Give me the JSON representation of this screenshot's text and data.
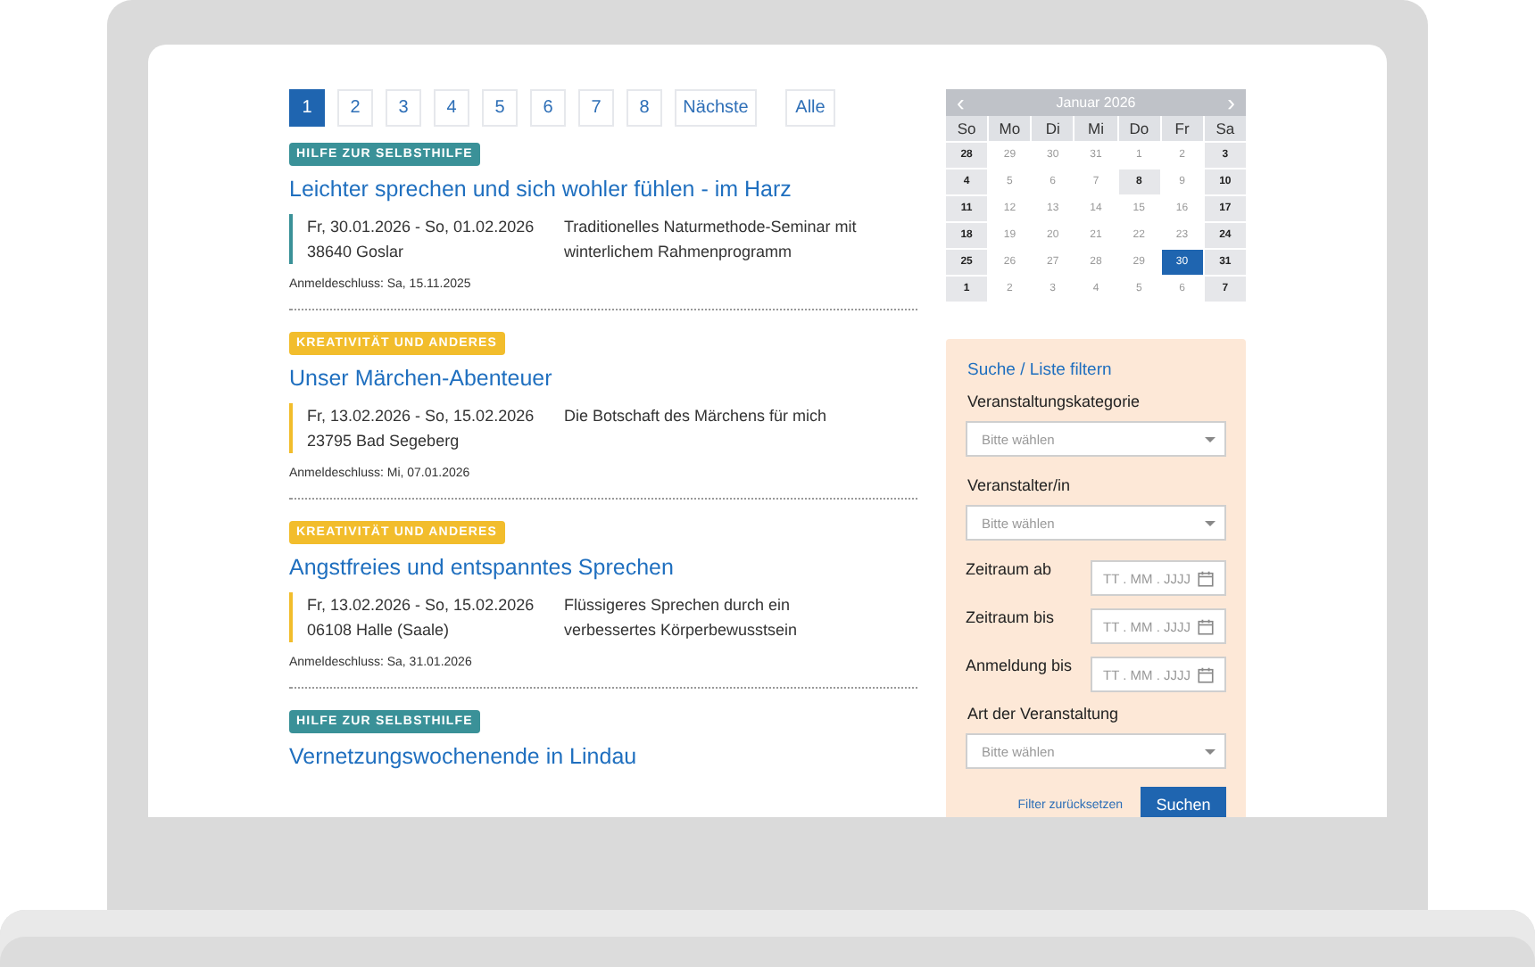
{
  "pagination": {
    "pages": [
      {
        "label": "1",
        "selected": true
      },
      {
        "label": "2",
        "selected": false
      },
      {
        "label": "3",
        "selected": false
      },
      {
        "label": "4",
        "selected": false
      },
      {
        "label": "5",
        "selected": false
      },
      {
        "label": "6",
        "selected": false
      },
      {
        "label": "7",
        "selected": false
      },
      {
        "label": "8",
        "selected": false
      }
    ],
    "next": "Nächste",
    "all": "Alle"
  },
  "events": [
    {
      "category": "HILFE ZUR SELBSTHILFE",
      "color": "#3a9198",
      "title": "Leichter sprechen und sich wohler fühlen - im Harz",
      "dates": "Fr, 30.01.2026 - So, 01.02.2026",
      "location": "38640 Goslar",
      "description": "Traditionelles Naturmethode-Seminar mit winterlichem Rahmenprogramm",
      "deadline": "Anmeldeschluss: Sa, 15.11.2025"
    },
    {
      "category": "KREATIVITÄT UND ANDERES",
      "color": "#f2bd2c",
      "title": "Unser Märchen-Abenteuer",
      "dates": "Fr, 13.02.2026 - So, 15.02.2026",
      "location": "23795 Bad Segeberg",
      "description": "Die Botschaft des Märchens für mich",
      "deadline": "Anmeldeschluss: Mi, 07.01.2026"
    },
    {
      "category": "KREATIVITÄT UND ANDERES",
      "color": "#f2bd2c",
      "title": "Angstfreies und entspanntes Sprechen",
      "dates": "Fr, 13.02.2026 - So, 15.02.2026",
      "location": "06108 Halle (Saale)",
      "description": "Flüssigeres Sprechen durch ein verbessertes Körperbewusstsein",
      "deadline": "Anmeldeschluss: Sa, 31.01.2026"
    },
    {
      "category": "HILFE ZUR SELBSTHILFE",
      "color": "#3a9198",
      "title": "Vernetzungswochenende in Lindau"
    }
  ],
  "calendar": {
    "title": "Januar 2026",
    "prev": "‹",
    "next": "›",
    "weekdays": [
      "So",
      "Mo",
      "Di",
      "Mi",
      "Do",
      "Fr",
      "Sa"
    ],
    "weeks": [
      [
        {
          "day": "28",
          "highlighted": true,
          "selected": false
        },
        {
          "day": "29",
          "highlighted": false,
          "selected": false
        },
        {
          "day": "30",
          "highlighted": false,
          "selected": false
        },
        {
          "day": "31",
          "highlighted": false,
          "selected": false
        },
        {
          "day": "1",
          "highlighted": false,
          "selected": false
        },
        {
          "day": "2",
          "highlighted": false,
          "selected": false
        },
        {
          "day": "3",
          "highlighted": true,
          "selected": false
        }
      ],
      [
        {
          "day": "4",
          "highlighted": true,
          "selected": false
        },
        {
          "day": "5",
          "highlighted": false,
          "selected": false
        },
        {
          "day": "6",
          "highlighted": false,
          "selected": false
        },
        {
          "day": "7",
          "highlighted": false,
          "selected": false
        },
        {
          "day": "8",
          "highlighted": true,
          "selected": false
        },
        {
          "day": "9",
          "highlighted": false,
          "selected": false
        },
        {
          "day": "10",
          "highlighted": true,
          "selected": false
        }
      ],
      [
        {
          "day": "11",
          "highlighted": true,
          "selected": false
        },
        {
          "day": "12",
          "highlighted": false,
          "selected": false
        },
        {
          "day": "13",
          "highlighted": false,
          "selected": false
        },
        {
          "day": "14",
          "highlighted": false,
          "selected": false
        },
        {
          "day": "15",
          "highlighted": false,
          "selected": false
        },
        {
          "day": "16",
          "highlighted": false,
          "selected": false
        },
        {
          "day": "17",
          "highlighted": true,
          "selected": false
        }
      ],
      [
        {
          "day": "18",
          "highlighted": true,
          "selected": false
        },
        {
          "day": "19",
          "highlighted": false,
          "selected": false
        },
        {
          "day": "20",
          "highlighted": false,
          "selected": false
        },
        {
          "day": "21",
          "highlighted": false,
          "selected": false
        },
        {
          "day": "22",
          "highlighted": false,
          "selected": false
        },
        {
          "day": "23",
          "highlighted": false,
          "selected": false
        },
        {
          "day": "24",
          "highlighted": true,
          "selected": false
        }
      ],
      [
        {
          "day": "25",
          "highlighted": true,
          "selected": false
        },
        {
          "day": "26",
          "highlighted": false,
          "selected": false
        },
        {
          "day": "27",
          "highlighted": false,
          "selected": false
        },
        {
          "day": "28",
          "highlighted": false,
          "selected": false
        },
        {
          "day": "29",
          "highlighted": false,
          "selected": false
        },
        {
          "day": "30",
          "highlighted": false,
          "selected": true
        },
        {
          "day": "31",
          "highlighted": true,
          "selected": false
        }
      ],
      [
        {
          "day": "1",
          "highlighted": true,
          "selected": false
        },
        {
          "day": "2",
          "highlighted": false,
          "selected": false
        },
        {
          "day": "3",
          "highlighted": false,
          "selected": false
        },
        {
          "day": "4",
          "highlighted": false,
          "selected": false
        },
        {
          "day": "5",
          "highlighted": false,
          "selected": false
        },
        {
          "day": "6",
          "highlighted": false,
          "selected": false
        },
        {
          "day": "7",
          "highlighted": true,
          "selected": false
        }
      ]
    ]
  },
  "filter": {
    "title": "Suche / Liste filtern",
    "fields": [
      {
        "kind": "select",
        "label": "Veranstaltungskategorie",
        "placeholder": "Bitte wählen"
      },
      {
        "kind": "select",
        "label": "Veranstalter/in",
        "placeholder": "Bitte wählen"
      },
      {
        "kind": "date",
        "label": "Zeitraum ab",
        "placeholder": "TT . MM . JJJJ"
      },
      {
        "kind": "date",
        "label": "Zeitraum bis",
        "placeholder": "TT . MM . JJJJ"
      },
      {
        "kind": "date",
        "label": "Anmeldung bis",
        "placeholder": "TT . MM . JJJJ"
      },
      {
        "kind": "select",
        "label": "Art der Veranstaltung",
        "placeholder": "Bitte wählen"
      }
    ],
    "reset": "Filter zurücksetzen",
    "submit": "Suchen"
  }
}
